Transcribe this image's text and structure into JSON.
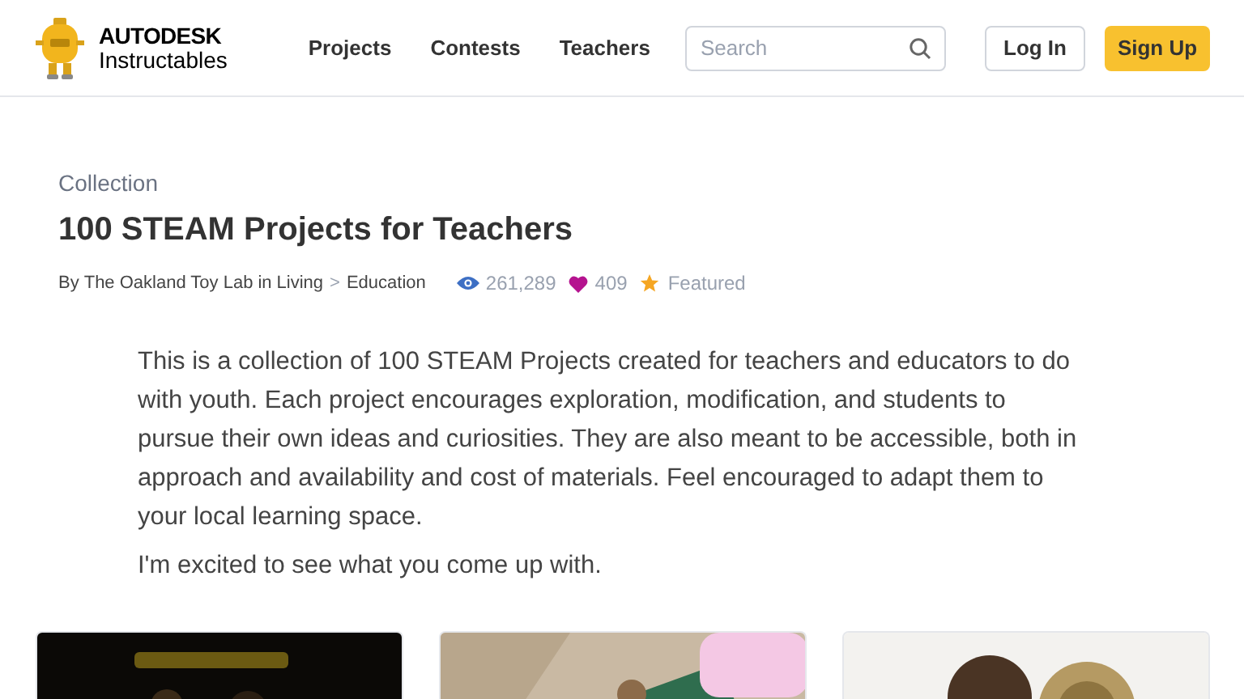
{
  "header": {
    "brand_top": "AUTODESK",
    "brand_bottom": "Instructables",
    "nav": [
      "Projects",
      "Contests",
      "Teachers"
    ],
    "search": {
      "placeholder": "Search"
    },
    "login": "Log In",
    "signup": "Sign Up"
  },
  "collection": {
    "label": "Collection",
    "title": "100 STEAM Projects for Teachers",
    "byline": {
      "prefix": "By",
      "author": "The Oakland Toy Lab",
      "joiner": "in",
      "category": "Living",
      "separator": ">",
      "subcategory": "Education"
    },
    "stats": {
      "views": "261,289",
      "likes": "409",
      "featured": "Featured"
    },
    "description": [
      "This is a collection of 100 STEAM Projects created for teachers and educators to do with youth. Each project encourages exploration, modification, and students to pursue their own ideas and curiosities. They are also meant to be accessible, both in approach and availability and cost of materials. Feel encouraged to adapt them to your local learning space.",
      "I'm excited to see what you come up with."
    ]
  }
}
